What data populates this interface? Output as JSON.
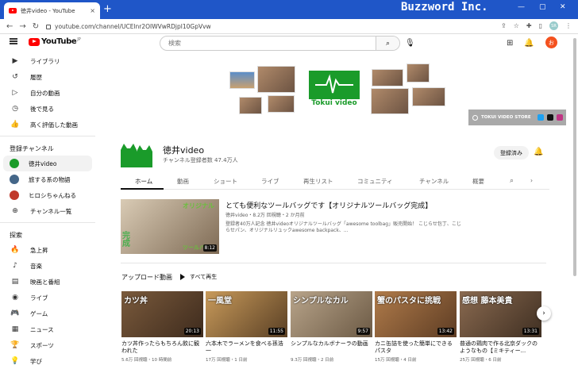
{
  "browser": {
    "tab_title": "徳井video - YouTube",
    "tab_close": "×",
    "new_tab": "+",
    "url": "youtube.com/channel/UCElnr2OIWVwRDjpl10GpVvw",
    "watermark": "Buzzword Inc.",
    "minimize": "—",
    "maximize": "▢",
    "close": "✕",
    "profile_initials": "SR"
  },
  "header": {
    "logo_text": "YouTube",
    "logo_region": "JP",
    "search_placeholder": "検索",
    "avatar_letter": "お"
  },
  "sidebar": {
    "main": [
      {
        "icon": "▶",
        "label": "ライブラリ"
      },
      {
        "icon": "↺",
        "label": "履歴"
      },
      {
        "icon": "▷",
        "label": "自分の動画"
      },
      {
        "icon": "◷",
        "label": "後で見る"
      },
      {
        "icon": "👍",
        "label": "高く評価した動画"
      }
    ],
    "subs_heading": "登録チャンネル",
    "subs": [
      {
        "label": "徳井video",
        "color": "#1a9b2a",
        "active": true
      },
      {
        "label": "旅する系の物語",
        "color": "#446688"
      },
      {
        "label": "ヒロシちゃんねる",
        "color": "#c0392b"
      },
      {
        "label": "チャンネル一覧",
        "color": ""
      }
    ],
    "explore_heading": "探索",
    "explore": [
      {
        "icon": "🔥",
        "label": "急上昇"
      },
      {
        "icon": "♪",
        "label": "音楽"
      },
      {
        "icon": "▤",
        "label": "映画と番組"
      },
      {
        "icon": "◉",
        "label": "ライブ"
      },
      {
        "icon": "🎮",
        "label": "ゲーム"
      },
      {
        "icon": "▦",
        "label": "ニュース"
      },
      {
        "icon": "🏆",
        "label": "スポーツ"
      },
      {
        "icon": "💡",
        "label": "学び"
      }
    ]
  },
  "banner": {
    "logo_text": "Tokui video",
    "store_label": "TOKUI VIDEO STORE"
  },
  "channel": {
    "name": "徳井video",
    "subscribers": "チャンネル登録者数 47.4万人",
    "subscribe_label": "登録済み"
  },
  "tabs": [
    "ホーム",
    "動画",
    "ショート",
    "ライブ",
    "再生リスト",
    "コミュニティ",
    "チャンネル",
    "概要"
  ],
  "featured": {
    "title": "とても便利なツールバッグです【オリジナルツールバッグ完成】",
    "meta": "徳井video・8.2万 回視聴・2 か月前",
    "description": "登録者40万人記念 徳井videoオリジナルツールバッグ「awesome toolbag」販売開始！ こじらせ包丁、こじらせパン、オリジナルリュックawesome backpack、...",
    "duration": "8:12",
    "overlay_top": "オリジナル",
    "overlay_bottom": "ツールバ",
    "overlay_left": "完成"
  },
  "uploads": {
    "heading": "アップロード動画",
    "play_all": "すべて再生",
    "videos": [
      {
        "title": "カツ丼作ったらもちろん飲に観われた",
        "meta": "5.6万 回視聴・10 時間前",
        "duration": "20:13",
        "overlay": "カツ丼"
      },
      {
        "title": "六本木でラーメンを食べる孫浩一",
        "meta": "17万 回視聴・1 日前",
        "duration": "11:55",
        "overlay": "一風堂"
      },
      {
        "title": "シンプルなカルボナーラの動画",
        "meta": "9.3万 回視聴・2 日前",
        "duration": "9:57",
        "overlay": "シンプルなカル"
      },
      {
        "title": "カニ缶詰を使った簡単にできるパスタ",
        "meta": "15万 回視聴・4 日前",
        "duration": "13:42",
        "overlay": "蟹のパスタに挑戦"
      },
      {
        "title": "普通の鶏肉で作る北京ダックのようなもの【ミキティー...",
        "meta": "25万 回視聴・6 日前",
        "duration": "13:31",
        "overlay": "感想 藤本美貴"
      }
    ]
  }
}
